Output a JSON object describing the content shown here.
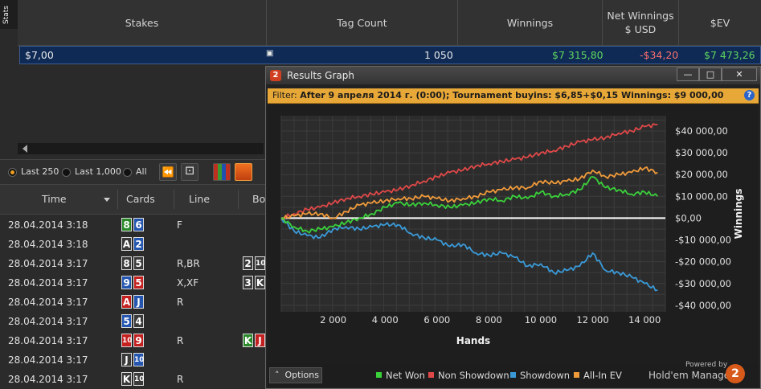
{
  "stats": {
    "tab_label": "Stats",
    "columns": [
      {
        "label": "Stakes"
      },
      {
        "label": "Tag Count"
      },
      {
        "label": "Winnings"
      },
      {
        "label": "Net Winnings $ USD"
      },
      {
        "label": "$EV"
      }
    ],
    "row": {
      "stakes": "$7,00",
      "tag_count": "1 050",
      "winnings": "$7 315,80",
      "net_winnings": "-$34,20",
      "ev": "$7 473,26"
    }
  },
  "toolbar": {
    "filters": [
      {
        "label": "Last 250",
        "selected": true
      },
      {
        "label": "Last 1,000",
        "selected": false
      },
      {
        "label": "All",
        "selected": false
      }
    ]
  },
  "hands": {
    "columns": [
      "Time",
      "Cards",
      "Line",
      "Bo"
    ],
    "rows": [
      {
        "time": "28.04.2014 3:18",
        "cards": [
          {
            "r": "8",
            "c": "green"
          },
          {
            "r": "6",
            "c": "blue"
          }
        ],
        "line": "F",
        "board": []
      },
      {
        "time": "28.04.2014 3:18",
        "cards": [
          {
            "r": "A",
            "c": "gray"
          },
          {
            "r": "2",
            "c": "blue"
          }
        ],
        "line": "",
        "board": []
      },
      {
        "time": "28.04.2014 3:17",
        "cards": [
          {
            "r": "8",
            "c": "gray"
          },
          {
            "r": "5",
            "c": "gray"
          }
        ],
        "line": "R,BR",
        "board": [
          {
            "r": "2",
            "c": "gray"
          },
          {
            "r": "10",
            "c": "gray"
          }
        ]
      },
      {
        "time": "28.04.2014 3:17",
        "cards": [
          {
            "r": "9",
            "c": "blue"
          },
          {
            "r": "5",
            "c": "red"
          }
        ],
        "line": "X,XF",
        "board": [
          {
            "r": "3",
            "c": "gray"
          },
          {
            "r": "K",
            "c": "gray"
          }
        ]
      },
      {
        "time": "28.04.2014 3:17",
        "cards": [
          {
            "r": "A",
            "c": "red"
          },
          {
            "r": "J",
            "c": "blue"
          }
        ],
        "line": "R",
        "board": []
      },
      {
        "time": "28.04.2014 3:17",
        "cards": [
          {
            "r": "5",
            "c": "blue"
          },
          {
            "r": "4",
            "c": "gray"
          }
        ],
        "line": "",
        "board": []
      },
      {
        "time": "28.04.2014 3:17",
        "cards": [
          {
            "r": "10",
            "c": "red"
          },
          {
            "r": "9",
            "c": "red"
          }
        ],
        "line": "R",
        "board": [
          {
            "r": "K",
            "c": "green"
          },
          {
            "r": "J",
            "c": "red"
          }
        ]
      },
      {
        "time": "28.04.2014 3:17",
        "cards": [
          {
            "r": "J",
            "c": "gray"
          },
          {
            "r": "10",
            "c": "blue"
          }
        ],
        "line": "",
        "board": []
      },
      {
        "time": "28.04.2014 3:17",
        "cards": [
          {
            "r": "K",
            "c": "gray"
          },
          {
            "r": "10",
            "c": "gray"
          }
        ],
        "line": "R",
        "board": []
      }
    ]
  },
  "graph_window": {
    "title": "Results Graph",
    "logo_text": "2",
    "filter_label": "Filter:",
    "filter_text": "After 9 апреля 2014 г. (0:00); Tournament buyins: $6,85+$0,15  Winnings: $9 000,00",
    "options_label": "Options",
    "powered_by": "Powered by",
    "brand": "Hold'em Manager",
    "brand_logo": "2"
  },
  "chart_data": {
    "type": "line",
    "xlabel": "Hands",
    "ylabel": "Winnings",
    "xlim": [
      0,
      14800
    ],
    "ylim": [
      -43000,
      47000
    ],
    "x_ticks": [
      2000,
      4000,
      6000,
      8000,
      10000,
      12000,
      14000
    ],
    "x_tick_labels": [
      "2 000",
      "4 000",
      "6 000",
      "8 000",
      "10 000",
      "12 000",
      "14 000"
    ],
    "y_ticks": [
      40000,
      30000,
      20000,
      10000,
      0,
      -10000,
      -20000,
      -30000,
      -40000
    ],
    "y_tick_labels": [
      "$40 000,00",
      "$30 000,00",
      "$20 000,00",
      "$10 000,00",
      "$0,00",
      "-$10 000,00",
      "-$20 000,00",
      "-$30 000,00",
      "-$40 000,00"
    ],
    "grid": true,
    "legend_position": "bottom",
    "x": [
      0,
      500,
      1000,
      1500,
      2000,
      2500,
      3000,
      3500,
      4000,
      4500,
      5000,
      5500,
      6000,
      6500,
      7000,
      7500,
      8000,
      8500,
      9000,
      9500,
      10000,
      10500,
      11000,
      11500,
      12000,
      12500,
      13000,
      13500,
      14000,
      14500
    ],
    "series": [
      {
        "name": "Net Won",
        "color": "#3ad13a",
        "values": [
          0,
          -4000,
          -6000,
          -5000,
          -4000,
          -2000,
          0,
          2000,
          5000,
          7000,
          6000,
          7000,
          6000,
          5000,
          6000,
          7000,
          9000,
          8000,
          10000,
          9000,
          12000,
          10000,
          11000,
          13000,
          19000,
          14000,
          13000,
          11000,
          12000,
          10000
        ]
      },
      {
        "name": "Non Showdown",
        "color": "#e04848",
        "values": [
          0,
          2000,
          4000,
          5000,
          7000,
          9000,
          10000,
          11000,
          12000,
          13000,
          15000,
          17000,
          19000,
          21000,
          22000,
          24000,
          25000,
          26000,
          27000,
          28000,
          30000,
          31000,
          33000,
          35000,
          36000,
          37000,
          39000,
          40000,
          42000,
          43000
        ]
      },
      {
        "name": "Showdown",
        "color": "#3a9ad8",
        "values": [
          0,
          -6000,
          -8000,
          -9000,
          -5000,
          -4000,
          -5000,
          -4000,
          -3000,
          -3000,
          -7000,
          -9000,
          -10000,
          -13000,
          -12000,
          -16000,
          -17000,
          -16000,
          -18000,
          -22000,
          -21000,
          -25000,
          -24000,
          -22000,
          -16000,
          -24000,
          -25000,
          -27000,
          -30000,
          -33000
        ]
      },
      {
        "name": "All-In EV",
        "color": "#f09a3a",
        "values": [
          0,
          1000,
          2000,
          2000,
          0,
          3000,
          6000,
          7000,
          8000,
          9000,
          9000,
          10000,
          9000,
          8000,
          9000,
          10000,
          12000,
          13000,
          14000,
          14000,
          17000,
          16000,
          17000,
          18000,
          22000,
          19000,
          20000,
          21000,
          23000,
          21000
        ]
      }
    ]
  }
}
